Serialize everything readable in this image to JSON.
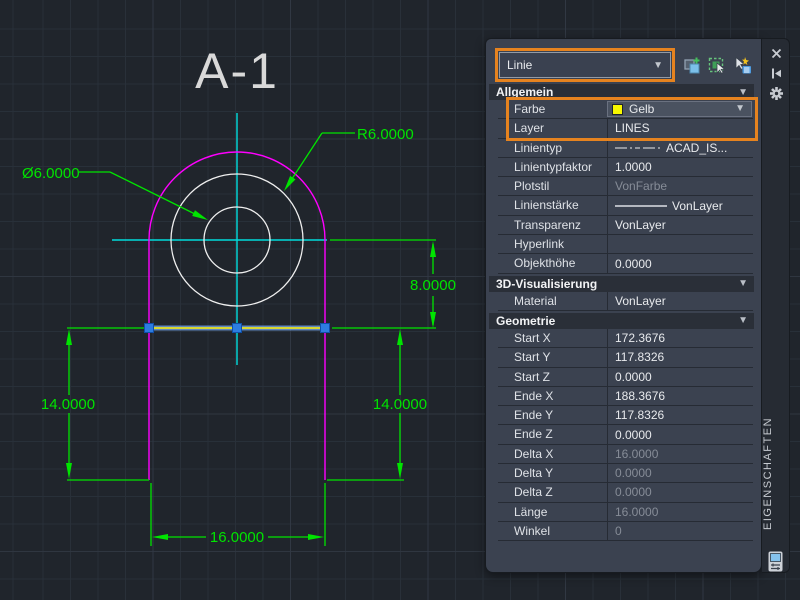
{
  "drawing": {
    "title": "A-1",
    "dims": {
      "diameter": "Ø6.0000",
      "radius": "R6.0000",
      "height": "8.0000",
      "left": "14.0000",
      "right": "14.0000",
      "width": "16.0000"
    },
    "colors": {
      "outline": "#FF00FF",
      "circles": "#EFEFEF",
      "centerline": "#00DCDC",
      "dimension": "#00E400",
      "selected_line": "#FFF200",
      "grip": "#2D7CE0"
    }
  },
  "panel": {
    "object_selector": {
      "value": "Linie"
    },
    "toolbar": [
      {
        "name": "toggle-pickadd-button"
      },
      {
        "name": "select-objects-button"
      },
      {
        "name": "quick-select-button"
      }
    ],
    "titlebar": {
      "title": "EIGENSCHAFTEN"
    },
    "highlight_color": "#E6831F",
    "sections": [
      {
        "label": "Allgemein",
        "rows": [
          {
            "label": "Farbe",
            "value": "Gelb",
            "type": "color"
          },
          {
            "label": "Layer",
            "value": "LINES"
          },
          {
            "label": "Linientyp",
            "value": "ACAD_IS...",
            "type": "linetype"
          },
          {
            "label": "Linientypfaktor",
            "value": "1.0000"
          },
          {
            "label": "Plotstil",
            "value": "VonFarbe",
            "muted": true
          },
          {
            "label": "Linienstärke",
            "value": "VonLayer",
            "type": "lineweight"
          },
          {
            "label": "Transparenz",
            "value": "VonLayer"
          },
          {
            "label": "Hyperlink",
            "value": ""
          },
          {
            "label": "Objekthöhe",
            "value": "0.0000"
          }
        ]
      },
      {
        "label": "3D-Visualisierung",
        "rows": [
          {
            "label": "Material",
            "value": "VonLayer"
          }
        ]
      },
      {
        "label": "Geometrie",
        "rows": [
          {
            "label": "Start X",
            "value": "172.3676"
          },
          {
            "label": "Start Y",
            "value": "117.8326"
          },
          {
            "label": "Start Z",
            "value": "0.0000"
          },
          {
            "label": "Ende X",
            "value": "188.3676"
          },
          {
            "label": "Ende Y",
            "value": "117.8326"
          },
          {
            "label": "Ende Z",
            "value": "0.0000"
          },
          {
            "label": "Delta X",
            "value": "16.0000",
            "muted": true
          },
          {
            "label": "Delta Y",
            "value": "0.0000",
            "muted": true
          },
          {
            "label": "Delta Z",
            "value": "0.0000",
            "muted": true
          },
          {
            "label": "Länge",
            "value": "16.0000",
            "muted": true
          },
          {
            "label": "Winkel",
            "value": "0",
            "muted": true
          }
        ]
      }
    ]
  }
}
